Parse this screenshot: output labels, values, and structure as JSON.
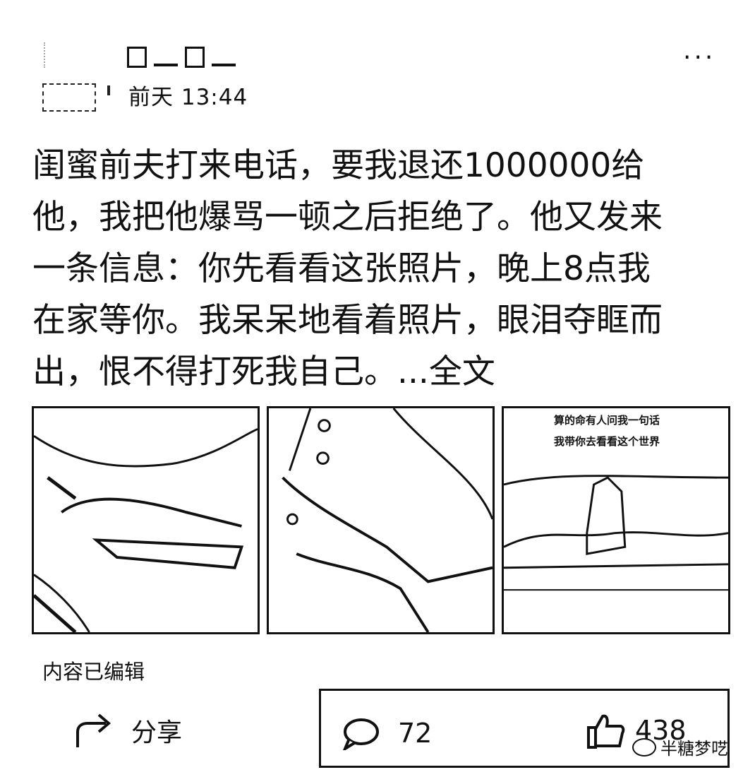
{
  "header": {
    "time": "前天 13:44",
    "more_label": "···"
  },
  "post": {
    "lines": [
      "闺蜜前夫打来电话，要我退还1000000给",
      "他，我把他爆骂一顿之后拒绝了。他又发来",
      "一条信息：你先看看这张照片，晚上8点我",
      "在家等你。我呆呆地看着照片，眼泪夺眶而",
      "出，恨不得打死我自己。..."
    ],
    "full_text_link": "全文"
  },
  "images": {
    "caption_lines": [
      "算的命有人问我一句话",
      "我带你去看看这个世界"
    ]
  },
  "edited_label": "内容已编辑",
  "actions": {
    "share_label": "分享",
    "comment_count": "72",
    "like_count": "438"
  },
  "watermark": "半糖梦呓"
}
